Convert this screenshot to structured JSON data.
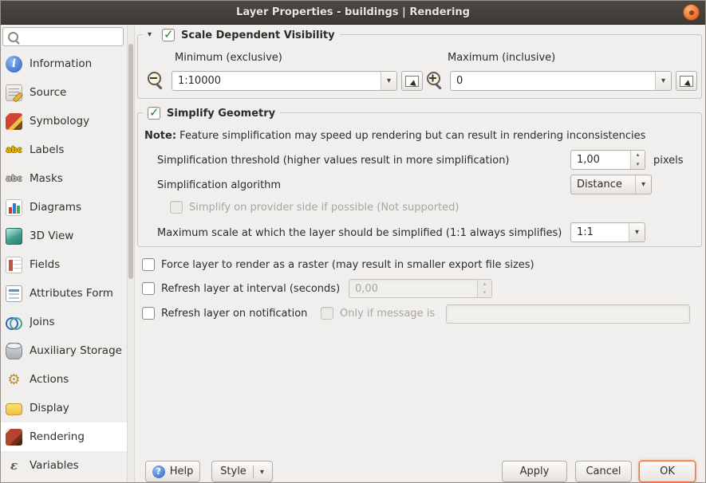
{
  "window": {
    "title": "Layer Properties - buildings | Rendering"
  },
  "sidebar": {
    "search_placeholder": "",
    "selected": "Rendering",
    "items": [
      {
        "label": "Information",
        "icon": "information-icon"
      },
      {
        "label": "Source",
        "icon": "source-icon"
      },
      {
        "label": "Symbology",
        "icon": "symbology-icon"
      },
      {
        "label": "Labels",
        "icon": "labels-icon"
      },
      {
        "label": "Masks",
        "icon": "masks-icon"
      },
      {
        "label": "Diagrams",
        "icon": "diagrams-icon"
      },
      {
        "label": "3D View",
        "icon": "view3d-icon"
      },
      {
        "label": "Fields",
        "icon": "fields-icon"
      },
      {
        "label": "Attributes Form",
        "icon": "attributes-form-icon"
      },
      {
        "label": "Joins",
        "icon": "joins-icon"
      },
      {
        "label": "Auxiliary Storage",
        "icon": "auxiliary-storage-icon"
      },
      {
        "label": "Actions",
        "icon": "actions-icon"
      },
      {
        "label": "Display",
        "icon": "display-icon"
      },
      {
        "label": "Rendering",
        "icon": "rendering-icon"
      },
      {
        "label": "Variables",
        "icon": "variables-icon"
      }
    ]
  },
  "scale_group": {
    "title": "Scale Dependent Visibility",
    "checked": true,
    "min_label": "Minimum (exclusive)",
    "max_label": "Maximum (inclusive)",
    "min_value": "1:10000",
    "max_value": "0"
  },
  "simplify_group": {
    "title": "Simplify Geometry",
    "checked": true,
    "note_prefix": "Note:",
    "note_text": " Feature simplification may speed up rendering but can result in rendering inconsistencies",
    "threshold_label": "Simplification threshold (higher values result in more simplification)",
    "threshold_value": "1,00",
    "threshold_unit": "pixels",
    "algorithm_label": "Simplification algorithm",
    "algorithm_value": "Distance",
    "provider_label": "Simplify on provider side if possible (Not supported)",
    "provider_checked": false,
    "max_scale_label": "Maximum scale at which the layer should be simplified (1:1 always simplifies)",
    "max_scale_value": "1:1"
  },
  "options": {
    "force_raster_label": "Force layer to render as a raster (may result in smaller export file sizes)",
    "force_raster_checked": false,
    "refresh_interval_label": "Refresh layer at interval (seconds)",
    "refresh_interval_checked": false,
    "refresh_interval_value": "0,00",
    "refresh_notification_label": "Refresh layer on notification",
    "refresh_notification_checked": false,
    "only_if_message_label": "Only if message is",
    "only_if_message_checked": false,
    "notification_message_value": ""
  },
  "footer": {
    "help_label": "Help",
    "style_label": "Style",
    "apply_label": "Apply",
    "cancel_label": "Cancel",
    "ok_label": "OK"
  },
  "colors": {
    "titlebar": "#45413b",
    "close_button": "#ee6f2d",
    "check": "#2e7d32",
    "default_button_border": "#e9763f",
    "selected_item_bg": "#ffffff"
  }
}
